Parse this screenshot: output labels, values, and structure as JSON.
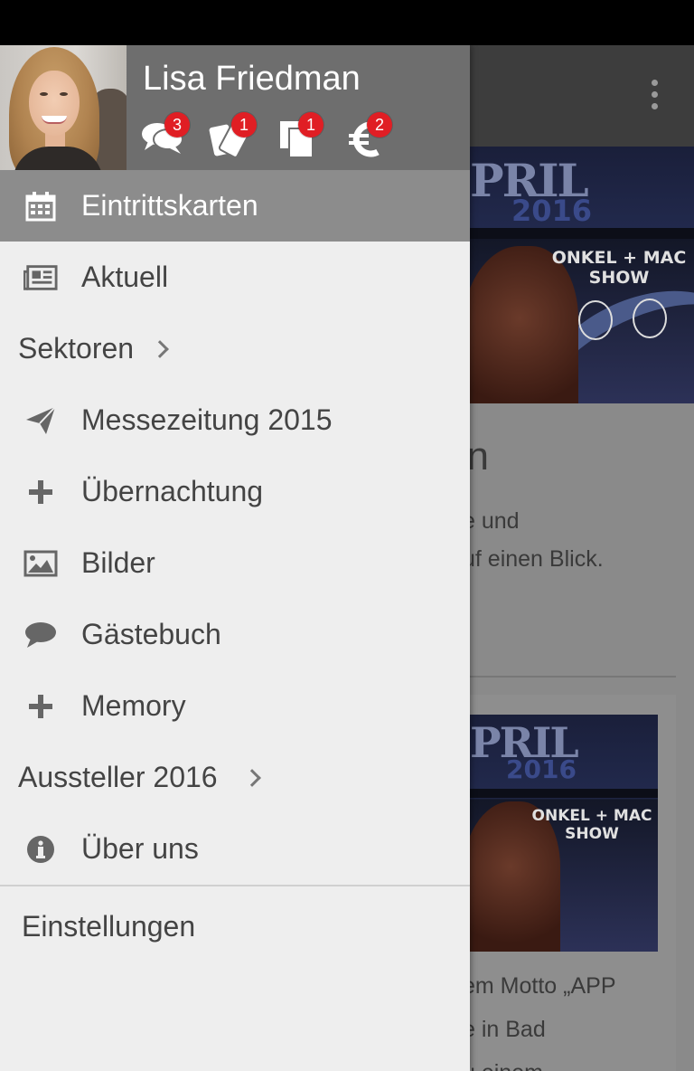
{
  "user": {
    "name": "Lisa Friedman"
  },
  "header_icons": [
    {
      "icon": "chat-bubbles-icon",
      "badge": "3"
    },
    {
      "icon": "tickets-icon",
      "badge": "1"
    },
    {
      "icon": "documents-icon",
      "badge": "1"
    },
    {
      "icon": "euro-icon",
      "badge": "2"
    }
  ],
  "menu": {
    "items": [
      {
        "label": "Eintrittskarten",
        "icon": "calendar-icon",
        "active": true
      },
      {
        "label": "Aktuell",
        "icon": "newspaper-icon"
      },
      {
        "label": "Sektoren",
        "section": true
      },
      {
        "label": "Messezeitung 2015",
        "icon": "paper-plane-icon"
      },
      {
        "label": "Übernachtung",
        "icon": "plus-icon"
      },
      {
        "label": "Bilder",
        "icon": "image-icon"
      },
      {
        "label": "Gästebuch",
        "icon": "speech-bubble-icon"
      },
      {
        "label": "Memory",
        "icon": "plus-icon"
      },
      {
        "label": "Aussteller 2016",
        "section": true
      },
      {
        "label": "Über uns",
        "icon": "info-icon"
      }
    ],
    "settings_label": "Einstellungen"
  },
  "background": {
    "banner_word": "PRIL",
    "banner_year": "2016",
    "banner_show": "ONKEL + MAC SHOW",
    "heading_fragment": "en",
    "text_line1": "e und",
    "text_line2": "uf einen Blick.",
    "text_line3": "em Motto „APP",
    "text_line4": "e in Bad",
    "text_line5": "u einem"
  },
  "colors": {
    "drawer_bg": "#eeeeee",
    "header_bg": "#6e6e6e",
    "active_item_bg": "#8c8c8c",
    "badge": "#e01e24"
  }
}
